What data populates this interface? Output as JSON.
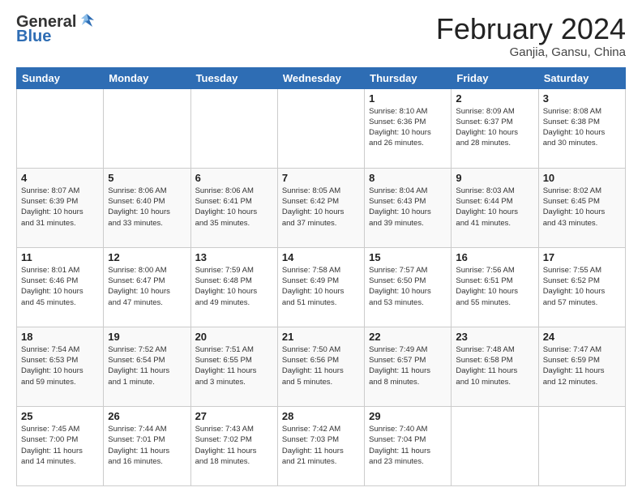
{
  "header": {
    "logo": {
      "line1": "General",
      "line2": "Blue"
    },
    "title": "February 2024",
    "location": "Ganjia, Gansu, China"
  },
  "days_of_week": [
    "Sunday",
    "Monday",
    "Tuesday",
    "Wednesday",
    "Thursday",
    "Friday",
    "Saturday"
  ],
  "weeks": [
    [
      {
        "day": "",
        "info": ""
      },
      {
        "day": "",
        "info": ""
      },
      {
        "day": "",
        "info": ""
      },
      {
        "day": "",
        "info": ""
      },
      {
        "day": "1",
        "info": "Sunrise: 8:10 AM\nSunset: 6:36 PM\nDaylight: 10 hours\nand 26 minutes."
      },
      {
        "day": "2",
        "info": "Sunrise: 8:09 AM\nSunset: 6:37 PM\nDaylight: 10 hours\nand 28 minutes."
      },
      {
        "day": "3",
        "info": "Sunrise: 8:08 AM\nSunset: 6:38 PM\nDaylight: 10 hours\nand 30 minutes."
      }
    ],
    [
      {
        "day": "4",
        "info": "Sunrise: 8:07 AM\nSunset: 6:39 PM\nDaylight: 10 hours\nand 31 minutes."
      },
      {
        "day": "5",
        "info": "Sunrise: 8:06 AM\nSunset: 6:40 PM\nDaylight: 10 hours\nand 33 minutes."
      },
      {
        "day": "6",
        "info": "Sunrise: 8:06 AM\nSunset: 6:41 PM\nDaylight: 10 hours\nand 35 minutes."
      },
      {
        "day": "7",
        "info": "Sunrise: 8:05 AM\nSunset: 6:42 PM\nDaylight: 10 hours\nand 37 minutes."
      },
      {
        "day": "8",
        "info": "Sunrise: 8:04 AM\nSunset: 6:43 PM\nDaylight: 10 hours\nand 39 minutes."
      },
      {
        "day": "9",
        "info": "Sunrise: 8:03 AM\nSunset: 6:44 PM\nDaylight: 10 hours\nand 41 minutes."
      },
      {
        "day": "10",
        "info": "Sunrise: 8:02 AM\nSunset: 6:45 PM\nDaylight: 10 hours\nand 43 minutes."
      }
    ],
    [
      {
        "day": "11",
        "info": "Sunrise: 8:01 AM\nSunset: 6:46 PM\nDaylight: 10 hours\nand 45 minutes."
      },
      {
        "day": "12",
        "info": "Sunrise: 8:00 AM\nSunset: 6:47 PM\nDaylight: 10 hours\nand 47 minutes."
      },
      {
        "day": "13",
        "info": "Sunrise: 7:59 AM\nSunset: 6:48 PM\nDaylight: 10 hours\nand 49 minutes."
      },
      {
        "day": "14",
        "info": "Sunrise: 7:58 AM\nSunset: 6:49 PM\nDaylight: 10 hours\nand 51 minutes."
      },
      {
        "day": "15",
        "info": "Sunrise: 7:57 AM\nSunset: 6:50 PM\nDaylight: 10 hours\nand 53 minutes."
      },
      {
        "day": "16",
        "info": "Sunrise: 7:56 AM\nSunset: 6:51 PM\nDaylight: 10 hours\nand 55 minutes."
      },
      {
        "day": "17",
        "info": "Sunrise: 7:55 AM\nSunset: 6:52 PM\nDaylight: 10 hours\nand 57 minutes."
      }
    ],
    [
      {
        "day": "18",
        "info": "Sunrise: 7:54 AM\nSunset: 6:53 PM\nDaylight: 10 hours\nand 59 minutes."
      },
      {
        "day": "19",
        "info": "Sunrise: 7:52 AM\nSunset: 6:54 PM\nDaylight: 11 hours\nand 1 minute."
      },
      {
        "day": "20",
        "info": "Sunrise: 7:51 AM\nSunset: 6:55 PM\nDaylight: 11 hours\nand 3 minutes."
      },
      {
        "day": "21",
        "info": "Sunrise: 7:50 AM\nSunset: 6:56 PM\nDaylight: 11 hours\nand 5 minutes."
      },
      {
        "day": "22",
        "info": "Sunrise: 7:49 AM\nSunset: 6:57 PM\nDaylight: 11 hours\nand 8 minutes."
      },
      {
        "day": "23",
        "info": "Sunrise: 7:48 AM\nSunset: 6:58 PM\nDaylight: 11 hours\nand 10 minutes."
      },
      {
        "day": "24",
        "info": "Sunrise: 7:47 AM\nSunset: 6:59 PM\nDaylight: 11 hours\nand 12 minutes."
      }
    ],
    [
      {
        "day": "25",
        "info": "Sunrise: 7:45 AM\nSunset: 7:00 PM\nDaylight: 11 hours\nand 14 minutes."
      },
      {
        "day": "26",
        "info": "Sunrise: 7:44 AM\nSunset: 7:01 PM\nDaylight: 11 hours\nand 16 minutes."
      },
      {
        "day": "27",
        "info": "Sunrise: 7:43 AM\nSunset: 7:02 PM\nDaylight: 11 hours\nand 18 minutes."
      },
      {
        "day": "28",
        "info": "Sunrise: 7:42 AM\nSunset: 7:03 PM\nDaylight: 11 hours\nand 21 minutes."
      },
      {
        "day": "29",
        "info": "Sunrise: 7:40 AM\nSunset: 7:04 PM\nDaylight: 11 hours\nand 23 minutes."
      },
      {
        "day": "",
        "info": ""
      },
      {
        "day": "",
        "info": ""
      }
    ]
  ]
}
